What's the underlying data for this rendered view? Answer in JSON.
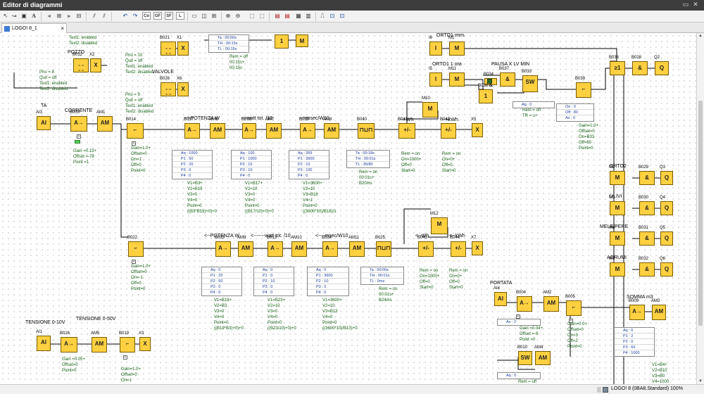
{
  "window": {
    "title": "Editor di diagrammi"
  },
  "tab": {
    "label": "LOGO! 8_1 Diagramma.lsc"
  },
  "toolbar": {
    "box_labels": [
      "Co",
      "GF",
      "SF",
      "L"
    ]
  },
  "status": {
    "text": "LOGO! 8 (0BA8.Standard) 100%"
  },
  "colors": {
    "block": "#ffd040",
    "param_text": "#146014",
    "table_text": "#1a3a9a",
    "wire": "#000000",
    "connector": "#58d058"
  },
  "blocks": [
    {
      "id": "b021",
      "num": "B021",
      "sym": "- -\n- -"
    },
    {
      "id": "x1",
      "num": "X1",
      "sym": "X"
    },
    {
      "id": "b012",
      "num": "B012",
      "sym": "- -\n- -"
    },
    {
      "id": "x2",
      "num": "X2",
      "sym": "X"
    },
    {
      "id": "b026",
      "num": "B026",
      "sym": "- -\n- -"
    },
    {
      "id": "x6",
      "num": "X6",
      "sym": "X"
    },
    {
      "id": "ai3",
      "num": "AI3",
      "sym": "AI"
    },
    {
      "id": "b003",
      "num": "B003",
      "sym": "A→"
    },
    {
      "id": "am1",
      "num": "AM1",
      "sym": "AM"
    },
    {
      "id": "b014",
      "num": "B014",
      "sym": "⌐"
    },
    {
      "id": "b017",
      "num": "B017",
      "sym": "A→"
    },
    {
      "id": "am6",
      "num": "AM6",
      "sym": "AM"
    },
    {
      "id": "b018",
      "num": "B018",
      "sym": "A→"
    },
    {
      "id": "am7",
      "num": "AM7",
      "sym": "AM"
    },
    {
      "id": "b020",
      "num": "B020",
      "sym": "A→"
    },
    {
      "id": "am8",
      "num": "AM8",
      "sym": "AM"
    },
    {
      "id": "b040",
      "num": "B040",
      "sym": "⊓⊔⊓"
    },
    {
      "id": "b041",
      "num": "B041",
      "sym": "+/-"
    },
    {
      "id": "m10",
      "num": "M10",
      "sym": "M"
    },
    {
      "id": "b042",
      "num": "B042",
      "sym": "+/-"
    },
    {
      "id": "x5",
      "num": "X5",
      "sym": "X"
    },
    {
      "id": "i6",
      "num": "I6",
      "sym": "I"
    },
    {
      "id": "m1",
      "num": "M1",
      "sym": "M"
    },
    {
      "id": "i5",
      "num": "I5",
      "sym": "I"
    },
    {
      "id": "m11",
      "num": "M11",
      "sym": "M"
    },
    {
      "id": "b034",
      "num": "B034",
      "sym": "&"
    },
    {
      "id": "b037",
      "num": "B037",
      "sym": "&"
    },
    {
      "id": "b038",
      "num": "B038",
      "sym": "1"
    },
    {
      "id": "b033",
      "num": "B033",
      "sym": "SW"
    },
    {
      "id": "b039",
      "num": "B039",
      "sym": "⌐"
    },
    {
      "id": "b036",
      "num": "B036",
      "sym": "≥1"
    },
    {
      "id": "b028",
      "num": "B028",
      "sym": "&"
    },
    {
      "id": "q2",
      "num": "Q2",
      "sym": "Q"
    },
    {
      "id": "b022",
      "num": "B022",
      "sym": "⌐"
    },
    {
      "id": "b023",
      "num": "B023",
      "sym": "A→"
    },
    {
      "id": "am9",
      "num": "AM9",
      "sym": "AM"
    },
    {
      "id": "b013",
      "num": "B013",
      "sym": "A→"
    },
    {
      "id": "am10",
      "num": "AM10",
      "sym": "AM"
    },
    {
      "id": "b024",
      "num": "B024",
      "sym": "A→"
    },
    {
      "id": "am11",
      "num": "AM11",
      "sym": "AM"
    },
    {
      "id": "b025",
      "num": "B025",
      "sym": "⊓⊔⊓"
    },
    {
      "id": "b043",
      "num": "B043",
      "sym": "+/-"
    },
    {
      "id": "m12",
      "num": "M12",
      "sym": "M"
    },
    {
      "id": "b044",
      "num": "B044",
      "sym": "+/-"
    },
    {
      "id": "x7",
      "num": "X7",
      "sym": "X"
    },
    {
      "id": "m2",
      "num": "M2",
      "sym": "M"
    },
    {
      "id": "b029",
      "num": "B029",
      "sym": "&"
    },
    {
      "id": "q3",
      "num": "Q3",
      "sym": "Q"
    },
    {
      "id": "m3",
      "num": "M3",
      "sym": "M"
    },
    {
      "id": "b030",
      "num": "B030",
      "sym": "&"
    },
    {
      "id": "q4",
      "num": "Q4",
      "sym": "Q"
    },
    {
      "id": "m6",
      "num": "M6",
      "sym": "M"
    },
    {
      "id": "b031",
      "num": "B031",
      "sym": "&"
    },
    {
      "id": "q5",
      "num": "Q5",
      "sym": "Q"
    },
    {
      "id": "m7",
      "num": "M7",
      "sym": "M"
    },
    {
      "id": "b032",
      "num": "B032",
      "sym": "&"
    },
    {
      "id": "q6",
      "num": "Q6",
      "sym": "Q"
    },
    {
      "id": "ai4",
      "num": "AI4",
      "sym": "AI"
    },
    {
      "id": "b004",
      "num": "B004",
      "sym": "A→"
    },
    {
      "id": "am2",
      "num": "AM2",
      "sym": "AM"
    },
    {
      "id": "b005",
      "num": "B005",
      "sym": "⌐"
    },
    {
      "id": "b009",
      "num": "B009",
      "sym": "A→"
    },
    {
      "id": "am3",
      "num": "AM3",
      "sym": "AM"
    },
    {
      "id": "b010",
      "num": "B010",
      "sym": "SW"
    },
    {
      "id": "am4",
      "num": "AM4",
      "sym": "AM"
    },
    {
      "id": "ai1",
      "num": "AI1",
      "sym": "AI"
    },
    {
      "id": "b016",
      "num": "B016",
      "sym": "A→"
    },
    {
      "id": "am5",
      "num": "AM5",
      "sym": "AM"
    },
    {
      "id": "b019",
      "num": "B019",
      "sym": "⌐"
    },
    {
      "id": "x3",
      "num": "X3",
      "sym": "X"
    },
    {
      "id": "top1",
      "num": "",
      "sym": "1"
    },
    {
      "id": "top2",
      "num": "",
      "sym": "M"
    }
  ],
  "labels": [
    {
      "id": "pozzo",
      "text": "POZZO"
    },
    {
      "id": "valvole",
      "text": "VALVOLE"
    },
    {
      "id": "ta",
      "text": "TA"
    },
    {
      "id": "corrente",
      "text": "CORRENTE"
    },
    {
      "id": "potw",
      "text": "-->POTENZA W"
    },
    {
      "id": "watt1",
      "text": "-->watt tot. /10"
    },
    {
      "id": "msec1",
      "text": "-->msec/W10"
    },
    {
      "id": "wh1",
      "text": "-->Wh"
    },
    {
      "id": "kwh1",
      "text": "-->kWh"
    },
    {
      "id": "orto1imm",
      "text": "ORTO1 imm."
    },
    {
      "id": "orto1ora",
      "text": "ORTO1 1 ora"
    },
    {
      "id": "pausa",
      "text": "PAUSA X LV MIN"
    },
    {
      "id": "potw2",
      "text": "<--POTENZA W"
    },
    {
      "id": "watt2",
      "text": "<-------watt tot. /10"
    },
    {
      "id": "msec2",
      "text": "<----msec/W10"
    },
    {
      "id": "wh2",
      "text": "<--Wh"
    },
    {
      "id": "kwh2",
      "text": "<--kWh"
    },
    {
      "id": "orto2",
      "text": "ORTO2"
    },
    {
      "id": "ulivi",
      "text": "ULIVI"
    },
    {
      "id": "melepere",
      "text": "MELE/PERE"
    },
    {
      "id": "agrumi",
      "text": "AGRUMI"
    },
    {
      "id": "portata",
      "text": "PORTATA"
    },
    {
      "id": "somma",
      "text": "SOMMA m3"
    },
    {
      "id": "tens10",
      "text": "TENSIONE 0-10V"
    },
    {
      "id": "tens50",
      "text": "TENSIONE 0-50V"
    }
  ],
  "params": [
    {
      "id": "p_top",
      "text": "Text1: enabled\nText2: disabled"
    },
    {
      "id": "p_b012",
      "text": "Prio = 10\nQuit = off\nText1: enabled\nText2: disabled"
    },
    {
      "id": "p_left",
      "text": "Prio = 8\nQuit = off\nText1: enabled\nText2: disabled"
    },
    {
      "id": "p_b026",
      "text": "Prio = 9\nQuit = off\nText1: enabled\nText2: disabled"
    },
    {
      "id": "p_b003",
      "text": "Gain =0.13+\nOffset =-78\nPoint =1"
    },
    {
      "id": "p_b014",
      "text": "Gain=1.0+\nOffset=0\nOn=1\nOff=0\nPoint=0"
    },
    {
      "id": "p_am6",
      "text": "V1=B3+\nV2=B19\nV3=0\nV4=0\nPoint=0\n((B3*B19)+0)+0"
    },
    {
      "id": "p_am7",
      "text": "V1=B17+\nV2=10\nV3=0\nV4=0\nPoint=0\n((B17/10)+0)+0"
    },
    {
      "id": "p_am8",
      "text": "V1=3600+\nV2=10\nV3=B18\nV4=1\nPoint=0\n((3600*10)/B18)/1"
    },
    {
      "id": "p_b040",
      "text": "Rem = on\n00:01s+\nB20ms"
    },
    {
      "id": "p_b041",
      "text": "Rem = on\nOn=1000+\nOff=0\nStart=0"
    },
    {
      "id": "p_b042",
      "text": "Rem = on\nOn=0+\nOff=0\nStart=0"
    },
    {
      "id": "p_b039",
      "text": "Gain=1.0+\nOffset=0\nOn=B33\nOff=80\nPoint=0"
    },
    {
      "id": "p_b039rem",
      "text": "Rem = off\nTR = s+"
    },
    {
      "id": "p_b022",
      "text": "Gain=1.0+\nOffset=0\nOn=-1\nOff=0\nPoint=0"
    },
    {
      "id": "p_am9",
      "text": "V1=B19+\nV2=B3\nV3=0\nV4=0\nPoint=0\n((B19*B3)+0)+0"
    },
    {
      "id": "p_am10",
      "text": "V1=B23+\nV2=10\nV3=0\nV4=0\nPoint=0\n((B23/10)+0)+0"
    },
    {
      "id": "p_am11",
      "text": "V1=3600+\nV2=10\nV3=B13\nV4=0\nPoint=0\n((3600*10)/B13)+0"
    },
    {
      "id": "p_b025",
      "text": "Rem = on\n00:01s+\nB24ms"
    },
    {
      "id": "p_b043",
      "text": "Rem = on\nOn=1000+\nOff=0\nStart=0"
    },
    {
      "id": "p_b044",
      "text": "Rem = on\nOn=0+\nOff=0\nStart=0"
    },
    {
      "id": "p_b004",
      "text": "Gain =0.04+\nOffset =-8\nPoint =0"
    },
    {
      "id": "p_b005",
      "text": "Gain=0.0+\nOffset=0\nOn=3\nOff=2\nPoint=0"
    },
    {
      "id": "p_am3",
      "text": "V1=B4+\nV2=B10\nV3=B0\nV4=1000\nPoint=0"
    },
    {
      "id": "p_b010",
      "text": "Rem = off"
    },
    {
      "id": "p_b016",
      "text": "Gain =0.05+\nOffset=0\nPoint=0"
    },
    {
      "id": "p_b019",
      "text": "Gain=1.0+\nOffset=0\nOn=1"
    },
    {
      "id": "p_toprem",
      "text": "Rem = off\n00:15s+\n00:15s"
    }
  ],
  "tables": [
    {
      "id": "t_top",
      "rows": [
        "Ta : 00:00s",
        "TH : 00:15s",
        "TL : 00:15s"
      ]
    },
    {
      "id": "t_am6",
      "rows": [
        "Aq : 1000",
        "P1 : 50",
        "P2 : 20",
        "P3 : 0",
        "P4 : 0"
      ]
    },
    {
      "id": "t_am7",
      "rows": [
        "Aq : 100",
        "P1 : 1000",
        "P2 : 10",
        "P3 : 10",
        "P4 : 0"
      ]
    },
    {
      "id": "t_am8",
      "rows": [
        "Aq : 359",
        "P1 : 3600",
        "P2 : 10",
        "P3 : 100",
        "P4 : 0"
      ]
    },
    {
      "id": "t_b040",
      "rows": [
        "Ta : 00:18s",
        "TH : 00:01s",
        "TL : 35/80"
      ]
    },
    {
      "id": "t_b039",
      "rows": [
        "On : 0",
        "Off : 80",
        "Ax : 0"
      ]
    },
    {
      "id": "t_b033",
      "rows": [
        "Aq : 0"
      ]
    },
    {
      "id": "t_am9",
      "rows": [
        "Aq : 0",
        "P1 : 20",
        "P2 : 50",
        "P3 : 0",
        "P4 : 0"
      ]
    },
    {
      "id": "t_am10",
      "rows": [
        "Aq : 0",
        "P1 : 0",
        "P2 : 10",
        "P3 : 0",
        "P4 : 0"
      ]
    },
    {
      "id": "t_am11",
      "rows": [
        "Aq : 0",
        "P1 : 3600",
        "P2 : 10",
        "P3 : 0",
        "P4 : 0"
      ]
    },
    {
      "id": "t_b025",
      "rows": [
        "Ta : 00:00s",
        "TH : 00:01s",
        "TL : 0ms"
      ]
    },
    {
      "id": "t_b004",
      "rows": [
        "Ax : 2"
      ]
    },
    {
      "id": "t_b010",
      "rows": [
        "Aq : 0"
      ]
    },
    {
      "id": "t_am3",
      "rows": [
        "Aq : 0",
        "P1 : 2",
        "P2 : 0",
        "P3 : 60",
        "P4 : 1000"
      ]
    },
    {
      "id": "t_b010b",
      "rows": [
        "Aq : 0"
      ]
    }
  ]
}
